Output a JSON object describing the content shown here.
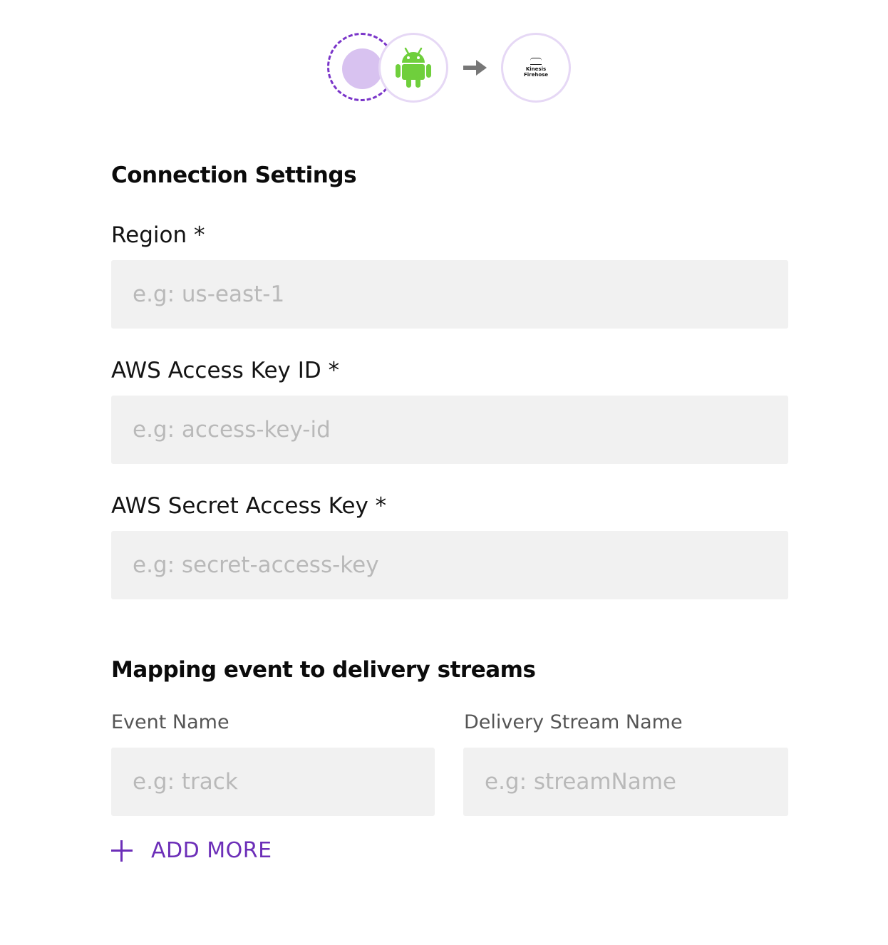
{
  "flow": {
    "source_icon": "source-placeholder-icon",
    "android_icon": "android-icon",
    "arrow_icon": "arrow-right-icon",
    "destination_icon": "kinesis-firehose-icon",
    "destination_logo_text": "Kinesis\nFirehose",
    "colors": {
      "accent": "#7a35c9",
      "source_fill": "#d8c2f0",
      "ring": "#e6d8f5",
      "android": "#6fcf3c",
      "arrow": "#777777"
    }
  },
  "connection_settings": {
    "title": "Connection Settings",
    "region": {
      "label": "Region *",
      "placeholder": "e.g: us-east-1",
      "value": ""
    },
    "access_key_id": {
      "label": "AWS Access Key ID *",
      "placeholder": "e.g: access-key-id",
      "value": ""
    },
    "secret_access_key": {
      "label": "AWS Secret Access Key *",
      "placeholder": "e.g: secret-access-key",
      "value": ""
    }
  },
  "mapping": {
    "title": "Mapping event to delivery streams",
    "event_name": {
      "label": "Event Name",
      "placeholder": "e.g: track",
      "value": ""
    },
    "stream_name": {
      "label": "Delivery Stream Name",
      "placeholder": "e.g: streamName",
      "value": ""
    },
    "add_more_label": "ADD MORE",
    "add_more_color": "#6c2eb8"
  }
}
